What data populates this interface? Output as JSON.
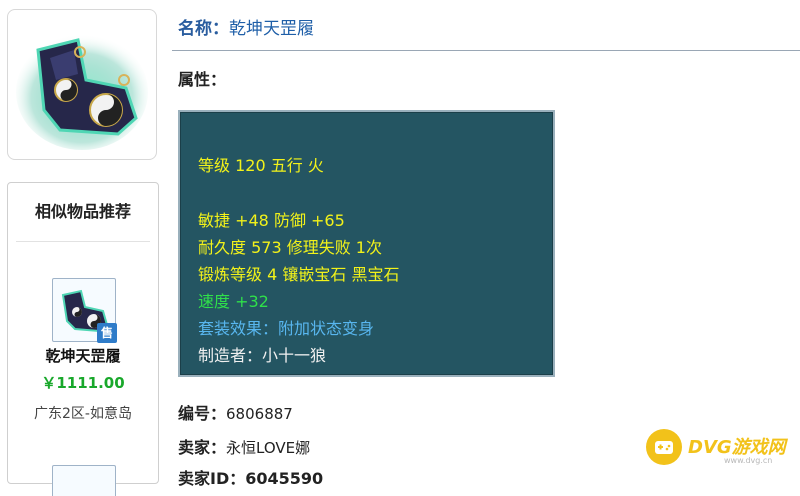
{
  "item": {
    "name_label": "名称：",
    "name_value": "乾坤天罡履",
    "attributes_label": "属性：",
    "attributes": {
      "level_line": "等级 120 五行 火",
      "stats_line": "敏捷 +48 防御 +65",
      "durability_line": "耐久度 573 修理失败 1次",
      "forge_line": "锻炼等级 4 镶嵌宝石 黑宝石",
      "speed_line": "速度 +32",
      "set_effect_line": "套装效果：附加状态变身",
      "maker_line": "制造者：小十一狼"
    },
    "id_label": "编号：",
    "id_value": "6806887",
    "seller_label": "卖家：",
    "seller_value": "永恒LOVE娜",
    "partial_row_text": "卖家ID：6045590"
  },
  "similar": {
    "title": "相似物品推荐",
    "items": [
      {
        "name": "乾坤天罡履",
        "price": "￥1111.00",
        "server": "广东2区-如意岛",
        "badge": "售"
      }
    ]
  },
  "watermark": {
    "text": "DVG游戏网",
    "sub": "www.dvg.cn"
  },
  "colors": {
    "name_blue": "#1f5fa8",
    "attr_bg": "#245562",
    "attr_yellow": "#f2f21a",
    "attr_green": "#2fe04a",
    "attr_blue": "#58b6ef",
    "price_green": "#19a82b",
    "badge_blue": "#2f7cc9",
    "watermark_yellow": "#f2c21a"
  },
  "icons": {
    "item_image": "boots-icon",
    "watermark_logo": "gamepad-icon"
  }
}
